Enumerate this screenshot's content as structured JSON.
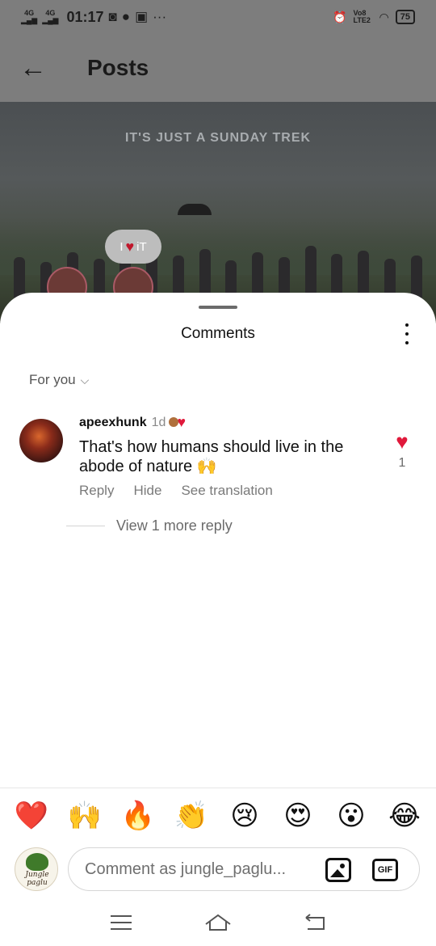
{
  "status_bar": {
    "signal_1": "4G",
    "signal_2": "4G",
    "time": "01:17",
    "volte": "Vo8 LTE2",
    "battery": "75"
  },
  "header": {
    "back_icon": "arrow-left-icon",
    "title": "Posts"
  },
  "post": {
    "overlay_text": "IT'S JUST A SUNDAY TREK",
    "badge_text_left": "I",
    "badge_text_right": "iT"
  },
  "sheet": {
    "title": "Comments",
    "filter_label": "For you"
  },
  "comments": [
    {
      "username": "apeexhunk",
      "time": "1d",
      "text": "That's how humans should live in the abode of nature 🙌",
      "like_count": "1",
      "actions": [
        "Reply",
        "Hide",
        "See translation"
      ],
      "view_replies": "View 1 more reply"
    }
  ],
  "emoji_bar": [
    "❤️",
    "🙌",
    "🔥",
    "👏",
    "😢",
    "😍",
    "😮",
    "😂"
  ],
  "input": {
    "placeholder": "Comment as jungle_paglu...",
    "avatar_brand": "Jungle paglu",
    "gif_label": "GIF"
  },
  "colors": {
    "like_red": "#e0193b",
    "dim_overlay": "#7d7d7d"
  }
}
